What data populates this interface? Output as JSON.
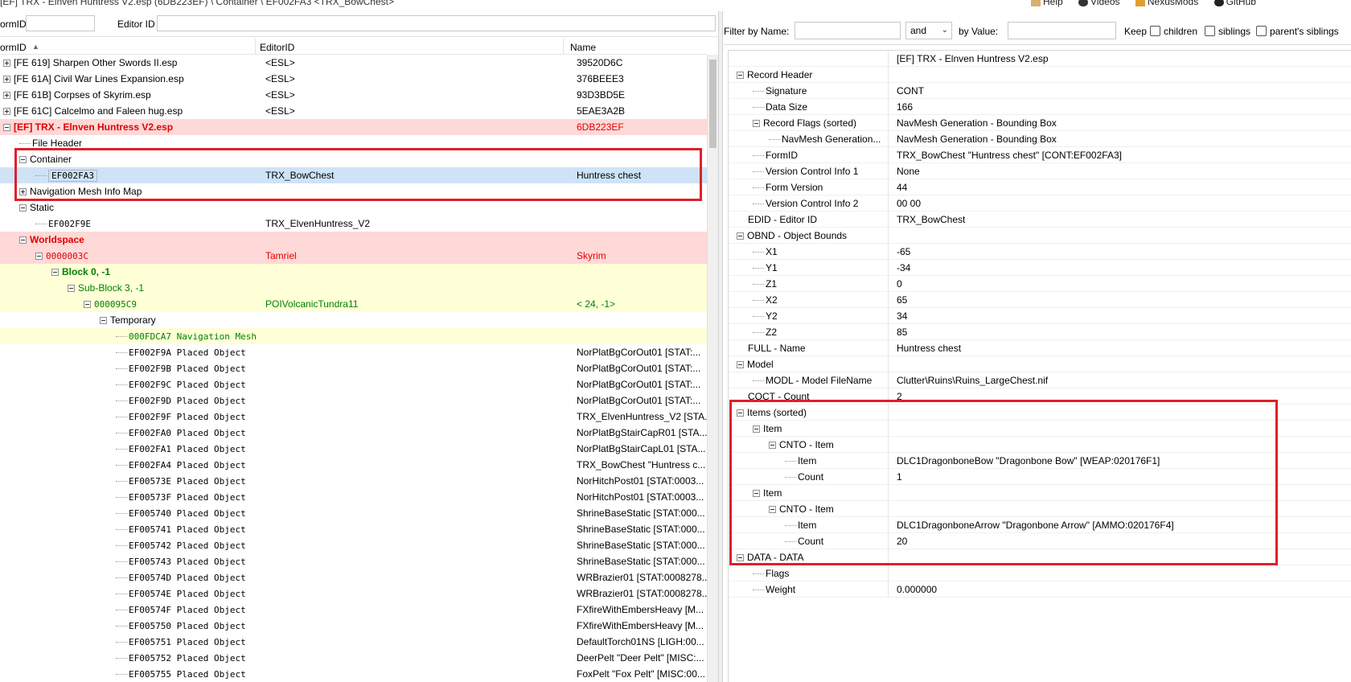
{
  "title": "[EF] TRX - Elnven Huntress V2.esp (6DB223EF) \\ Container \\ EF002FA3 <TRX_BowChest>",
  "top_links": [
    "Help",
    "Videos",
    "NexusMods",
    "GitHub"
  ],
  "left_filter": {
    "formid_label": "ormID",
    "editorid_label": "Editor ID",
    "formid_value": "",
    "editorid_value": ""
  },
  "left_columns": {
    "formid": "ormID",
    "editorid": "EditorID",
    "name": "Name"
  },
  "left_rows": [
    {
      "indent": 0,
      "exp": "plus",
      "id": "[FE 619] Sharpen Other Swords II.esp",
      "editor": "<ESL>",
      "name": "39520D6C",
      "style": ""
    },
    {
      "indent": 0,
      "exp": "plus",
      "id": "[FE 61A] Civil War Lines Expansion.esp",
      "editor": "<ESL>",
      "name": "376BEEE3",
      "style": ""
    },
    {
      "indent": 0,
      "exp": "plus",
      "id": "[FE 61B] Corpses of Skyrim.esp",
      "editor": "<ESL>",
      "name": "93D3BD5E",
      "style": ""
    },
    {
      "indent": 0,
      "exp": "plus",
      "id": "[FE 61C] Calcelmo and Faleen hug.esp",
      "editor": "<ESL>",
      "name": "5EAE3A2B",
      "style": ""
    },
    {
      "indent": 0,
      "exp": "minus",
      "id": "[EF] TRX - Elnven Huntress V2.esp",
      "editor": "",
      "name": "6DB223EF",
      "style": "pink red bold"
    },
    {
      "indent": 1,
      "exp": "",
      "id": "File Header",
      "editor": "",
      "name": "",
      "style": ""
    },
    {
      "indent": 1,
      "exp": "minus",
      "id": "Container",
      "editor": "",
      "name": "",
      "style": ""
    },
    {
      "indent": 2,
      "exp": "",
      "id": "EF002FA3",
      "editor": "TRX_BowChest",
      "name": "Huntress chest",
      "style": "selected mono-id"
    },
    {
      "indent": 1,
      "exp": "plus",
      "id": "Navigation Mesh Info Map",
      "editor": "",
      "name": "",
      "style": ""
    },
    {
      "indent": 1,
      "exp": "minus",
      "id": "Static",
      "editor": "",
      "name": "",
      "style": ""
    },
    {
      "indent": 2,
      "exp": "",
      "id": "EF002F9E",
      "editor": "TRX_ElvenHuntress_V2",
      "name": "",
      "style": "mono-id"
    },
    {
      "indent": 1,
      "exp": "minus",
      "id": "Worldspace",
      "editor": "",
      "name": "",
      "style": "pink red bold"
    },
    {
      "indent": 2,
      "exp": "minus",
      "id": "0000003C",
      "editor": "Tamriel",
      "name": "Skyrim",
      "style": "pink red mono-id"
    },
    {
      "indent": 3,
      "exp": "minus",
      "id": "Block 0, -1",
      "editor": "",
      "name": "",
      "style": "yellow green bold"
    },
    {
      "indent": 4,
      "exp": "minus",
      "id": "Sub-Block 3, -1",
      "editor": "",
      "name": "",
      "style": "yellow green"
    },
    {
      "indent": 5,
      "exp": "minus",
      "id": "000095C9",
      "editor": "POIVolcanicTundra11",
      "name": "< 24,  -1>",
      "style": "yellow green mono-id"
    },
    {
      "indent": 6,
      "exp": "minus",
      "id": "Temporary",
      "editor": "",
      "name": "",
      "style": ""
    },
    {
      "indent": 7,
      "exp": "",
      "id": "000FDCA7  Navigation Mesh",
      "editor": "",
      "name": "",
      "style": "yellow green mono-id"
    },
    {
      "indent": 7,
      "exp": "",
      "id": "EF002F9A  Placed Object",
      "editor": "",
      "name": "NorPlatBgCorOut01 [STAT:...",
      "style": "mono-id"
    },
    {
      "indent": 7,
      "exp": "",
      "id": "EF002F9B  Placed Object",
      "editor": "",
      "name": "NorPlatBgCorOut01 [STAT:...",
      "style": "mono-id"
    },
    {
      "indent": 7,
      "exp": "",
      "id": "EF002F9C  Placed Object",
      "editor": "",
      "name": "NorPlatBgCorOut01 [STAT:...",
      "style": "mono-id"
    },
    {
      "indent": 7,
      "exp": "",
      "id": "EF002F9D  Placed Object",
      "editor": "",
      "name": "NorPlatBgCorOut01 [STAT:...",
      "style": "mono-id"
    },
    {
      "indent": 7,
      "exp": "",
      "id": "EF002F9F  Placed Object",
      "editor": "",
      "name": "TRX_ElvenHuntress_V2 [STA...",
      "style": "mono-id"
    },
    {
      "indent": 7,
      "exp": "",
      "id": "EF002FA0  Placed Object",
      "editor": "",
      "name": "NorPlatBgStairCapR01 [STA...",
      "style": "mono-id"
    },
    {
      "indent": 7,
      "exp": "",
      "id": "EF002FA1  Placed Object",
      "editor": "",
      "name": "NorPlatBgStairCapL01 [STA...",
      "style": "mono-id"
    },
    {
      "indent": 7,
      "exp": "",
      "id": "EF002FA4  Placed Object",
      "editor": "",
      "name": "TRX_BowChest \"Huntress c...",
      "style": "mono-id"
    },
    {
      "indent": 7,
      "exp": "",
      "id": "EF00573E  Placed Object",
      "editor": "",
      "name": "NorHitchPost01 [STAT:0003...",
      "style": "mono-id"
    },
    {
      "indent": 7,
      "exp": "",
      "id": "EF00573F  Placed Object",
      "editor": "",
      "name": "NorHitchPost01 [STAT:0003...",
      "style": "mono-id"
    },
    {
      "indent": 7,
      "exp": "",
      "id": "EF005740  Placed Object",
      "editor": "",
      "name": "ShrineBaseStatic [STAT:000...",
      "style": "mono-id"
    },
    {
      "indent": 7,
      "exp": "",
      "id": "EF005741  Placed Object",
      "editor": "",
      "name": "ShrineBaseStatic [STAT:000...",
      "style": "mono-id"
    },
    {
      "indent": 7,
      "exp": "",
      "id": "EF005742  Placed Object",
      "editor": "",
      "name": "ShrineBaseStatic [STAT:000...",
      "style": "mono-id"
    },
    {
      "indent": 7,
      "exp": "",
      "id": "EF005743  Placed Object",
      "editor": "",
      "name": "ShrineBaseStatic [STAT:000...",
      "style": "mono-id"
    },
    {
      "indent": 7,
      "exp": "",
      "id": "EF00574D  Placed Object",
      "editor": "",
      "name": "WRBrazier01 [STAT:0008278...",
      "style": "mono-id"
    },
    {
      "indent": 7,
      "exp": "",
      "id": "EF00574E  Placed Object",
      "editor": "",
      "name": "WRBrazier01 [STAT:0008278...",
      "style": "mono-id"
    },
    {
      "indent": 7,
      "exp": "",
      "id": "EF00574F  Placed Object",
      "editor": "",
      "name": "FXfireWithEmbersHeavy [M...",
      "style": "mono-id"
    },
    {
      "indent": 7,
      "exp": "",
      "id": "EF005750  Placed Object",
      "editor": "",
      "name": "FXfireWithEmbersHeavy [M...",
      "style": "mono-id"
    },
    {
      "indent": 7,
      "exp": "",
      "id": "EF005751  Placed Object",
      "editor": "",
      "name": "DefaultTorch01NS [LIGH:00...",
      "style": "mono-id"
    },
    {
      "indent": 7,
      "exp": "",
      "id": "EF005752  Placed Object",
      "editor": "",
      "name": "DeerPelt \"Deer Pelt\" [MISC:...",
      "style": "mono-id"
    },
    {
      "indent": 7,
      "exp": "",
      "id": "EF005755  Placed Object",
      "editor": "",
      "name": "FoxPelt \"Fox Pelt\" [MISC:00...",
      "style": "mono-id"
    }
  ],
  "right_filter": {
    "by_name_label": "Filter by Name:",
    "name_value": "",
    "op_value": "and",
    "by_value_label": "by Value:",
    "value_value": "",
    "keep_label": "Keep",
    "children_label": "children",
    "siblings_label": "siblings",
    "parents_label": "parent's siblings"
  },
  "right_rows": [
    {
      "indent": 0,
      "exp": "",
      "key": "",
      "value": "[EF] TRX - Elnven Huntress V2.esp"
    },
    {
      "indent": 0,
      "exp": "minus",
      "key": "Record Header",
      "value": ""
    },
    {
      "indent": 1,
      "exp": "",
      "key": "Signature",
      "value": "CONT"
    },
    {
      "indent": 1,
      "exp": "",
      "key": "Data Size",
      "value": "166"
    },
    {
      "indent": 1,
      "exp": "minus",
      "key": "Record Flags (sorted)",
      "value": "NavMesh Generation - Bounding Box"
    },
    {
      "indent": 2,
      "exp": "",
      "key": "NavMesh Generation...",
      "value": "NavMesh Generation - Bounding Box"
    },
    {
      "indent": 1,
      "exp": "",
      "key": "FormID",
      "value": "TRX_BowChest \"Huntress chest\" [CONT:EF002FA3]"
    },
    {
      "indent": 1,
      "exp": "",
      "key": "Version Control Info 1",
      "value": "None"
    },
    {
      "indent": 1,
      "exp": "",
      "key": "Form Version",
      "value": "44"
    },
    {
      "indent": 1,
      "exp": "",
      "key": "Version Control Info 2",
      "value": "00 00"
    },
    {
      "indent": 0,
      "exp": "",
      "key": "EDID - Editor ID",
      "value": "TRX_BowChest"
    },
    {
      "indent": 0,
      "exp": "minus",
      "key": "OBND - Object Bounds",
      "value": ""
    },
    {
      "indent": 1,
      "exp": "",
      "key": "X1",
      "value": "-65"
    },
    {
      "indent": 1,
      "exp": "",
      "key": "Y1",
      "value": "-34"
    },
    {
      "indent": 1,
      "exp": "",
      "key": "Z1",
      "value": "0"
    },
    {
      "indent": 1,
      "exp": "",
      "key": "X2",
      "value": "65"
    },
    {
      "indent": 1,
      "exp": "",
      "key": "Y2",
      "value": "34"
    },
    {
      "indent": 1,
      "exp": "",
      "key": "Z2",
      "value": "85"
    },
    {
      "indent": 0,
      "exp": "",
      "key": "FULL - Name",
      "value": "Huntress chest"
    },
    {
      "indent": 0,
      "exp": "minus",
      "key": "Model",
      "value": ""
    },
    {
      "indent": 1,
      "exp": "",
      "key": "MODL - Model FileName",
      "value": "Clutter\\Ruins\\Ruins_LargeChest.nif"
    },
    {
      "indent": 0,
      "exp": "",
      "key": "COCT - Count",
      "value": "2"
    },
    {
      "indent": 0,
      "exp": "minus",
      "key": "Items (sorted)",
      "value": ""
    },
    {
      "indent": 1,
      "exp": "minus",
      "key": "Item",
      "value": ""
    },
    {
      "indent": 2,
      "exp": "minus",
      "key": "CNTO - Item",
      "value": ""
    },
    {
      "indent": 3,
      "exp": "",
      "key": "Item",
      "value": "DLC1DragonboneBow \"Dragonbone Bow\" [WEAP:020176F1]"
    },
    {
      "indent": 3,
      "exp": "",
      "key": "Count",
      "value": "1"
    },
    {
      "indent": 1,
      "exp": "minus",
      "key": "Item",
      "value": ""
    },
    {
      "indent": 2,
      "exp": "minus",
      "key": "CNTO - Item",
      "value": ""
    },
    {
      "indent": 3,
      "exp": "",
      "key": "Item",
      "value": "DLC1DragonboneArrow \"Dragonbone Arrow\" [AMMO:020176F4]"
    },
    {
      "indent": 3,
      "exp": "",
      "key": "Count",
      "value": "20"
    },
    {
      "indent": 0,
      "exp": "minus",
      "key": "DATA - DATA",
      "value": ""
    },
    {
      "indent": 1,
      "exp": "",
      "key": "Flags",
      "value": ""
    },
    {
      "indent": 1,
      "exp": "",
      "key": "Weight",
      "value": "0.000000"
    }
  ],
  "colors": {
    "annotation": "#e0202a",
    "pink_row": "#ffd8d8",
    "yellow_row": "#ffffd8",
    "selected_row": "#cfe3f7",
    "red_text": "#e00000",
    "green_text": "#008000"
  }
}
